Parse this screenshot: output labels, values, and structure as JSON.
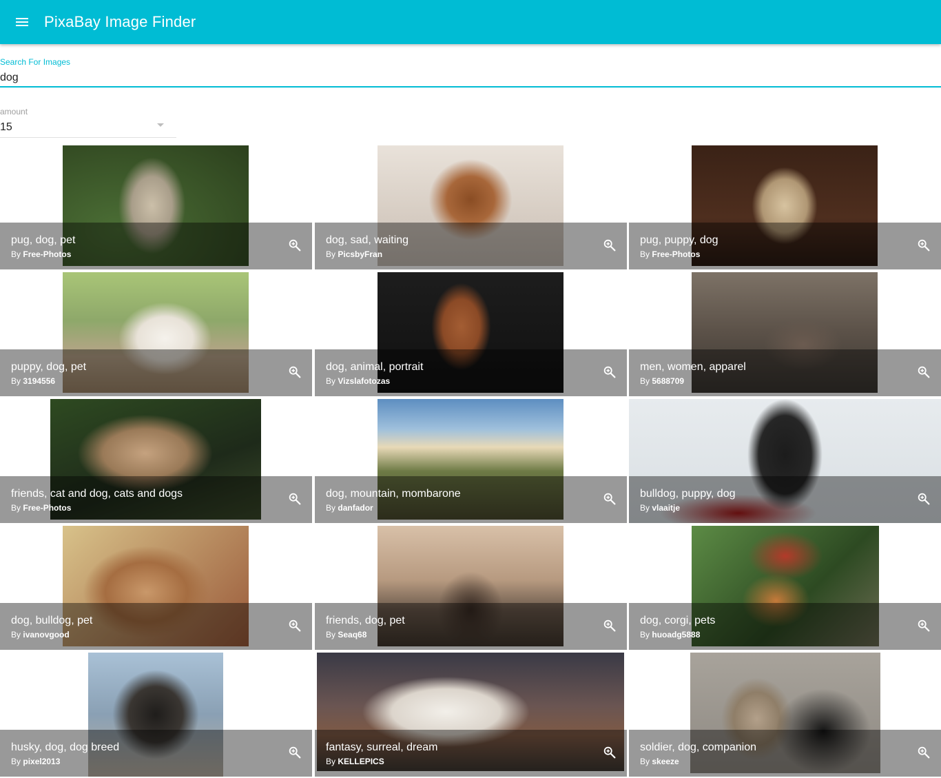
{
  "app": {
    "title": "PixaBay Image Finder",
    "menu_icon": "menu-icon"
  },
  "search": {
    "label": "Search For Images",
    "value": "dog"
  },
  "amount": {
    "label": "amount",
    "value": "15"
  },
  "colors": {
    "accent": "#00bcd4",
    "tile_bar": "rgba(0,0,0,0.4)"
  },
  "by_prefix": "By",
  "images": [
    {
      "tags": "pug, dog, pet",
      "user": "Free-Photos"
    },
    {
      "tags": "dog, sad, waiting",
      "user": "PicsbyFran"
    },
    {
      "tags": "pug, puppy, dog",
      "user": "Free-Photos"
    },
    {
      "tags": "puppy, dog, pet",
      "user": "3194556"
    },
    {
      "tags": "dog, animal, portrait",
      "user": "Vizslafotozas"
    },
    {
      "tags": "men, women, apparel",
      "user": "5688709"
    },
    {
      "tags": "friends, cat and dog, cats and dogs",
      "user": "Free-Photos"
    },
    {
      "tags": "dog, mountain, mombarone",
      "user": "danfador"
    },
    {
      "tags": "bulldog, puppy, dog",
      "user": "vlaaitje"
    },
    {
      "tags": "dog, bulldog, pet",
      "user": "ivanovgood"
    },
    {
      "tags": "friends, dog, pet",
      "user": "Seaq68"
    },
    {
      "tags": "dog, corgi, pets",
      "user": "huoadg5888"
    },
    {
      "tags": "husky, dog, dog breed",
      "user": "pixel2013"
    },
    {
      "tags": "fantasy, surreal, dream",
      "user": "KELLEPICS"
    },
    {
      "tags": "soldier, dog, companion",
      "user": "skeeze"
    }
  ]
}
